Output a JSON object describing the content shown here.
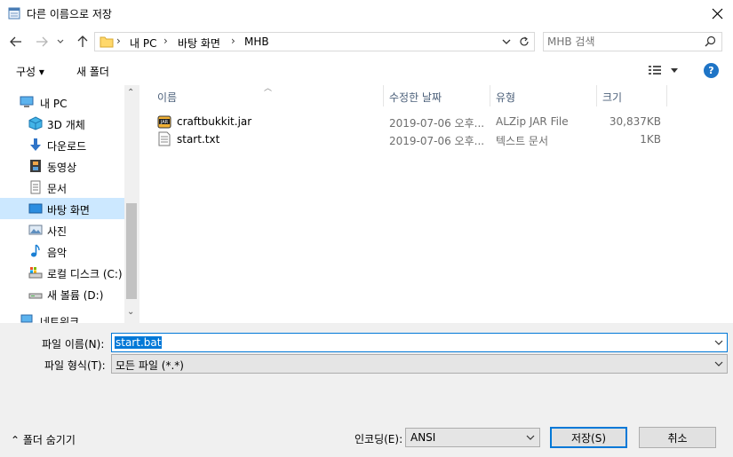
{
  "window": {
    "title": "다른 이름으로 저장",
    "close_glyph": "✕"
  },
  "address": {
    "breadcrumb": [
      "내 PC",
      "바탕 화면",
      "MHB"
    ],
    "separator": "›"
  },
  "search": {
    "placeholder": "MHB 검색"
  },
  "toolbar": {
    "organize_label": "구성 ▾",
    "new_folder_label": "새 폴더",
    "help_label": "?"
  },
  "nav": {
    "items": [
      {
        "label": "내 PC",
        "icon": "computer-icon"
      },
      {
        "label": "3D 개체",
        "icon": "cube-icon"
      },
      {
        "label": "다운로드",
        "icon": "download-icon"
      },
      {
        "label": "동영상",
        "icon": "film-icon"
      },
      {
        "label": "문서",
        "icon": "document-icon"
      },
      {
        "label": "바탕 화면",
        "icon": "desktop-icon",
        "selected": true
      },
      {
        "label": "사진",
        "icon": "pictures-icon"
      },
      {
        "label": "음악",
        "icon": "music-icon"
      },
      {
        "label": "로컬 디스크 (C:)",
        "icon": "drive-c-icon"
      },
      {
        "label": "새 볼륨 (D:)",
        "icon": "drive-d-icon"
      },
      {
        "label": "네트워크",
        "icon": "network-icon"
      }
    ]
  },
  "files": {
    "columns": [
      "이름",
      "수정한 날짜",
      "유형",
      "크기"
    ],
    "rows": [
      {
        "name": "craftbukkit.jar",
        "date": "2019-07-06 오후...",
        "type": "ALZip JAR File",
        "size": "30,837KB",
        "icon": "jar-icon"
      },
      {
        "name": "start.txt",
        "date": "2019-07-06 오후...",
        "type": "텍스트 문서",
        "size": "1KB",
        "icon": "text-file-icon"
      }
    ]
  },
  "form": {
    "filename_label": "파일 이름(N):",
    "filename_value": "start.bat",
    "filetype_label": "파일 형식(T):",
    "filetype_value": "모든 파일 (*.*)",
    "hide_folders_label": "⌃  폴더 숨기기",
    "encoding_label": "인코딩(E):",
    "encoding_value": "ANSI",
    "save_label": "저장(S)",
    "cancel_label": "취소"
  },
  "colors": {
    "accent": "#0078d7",
    "selection": "#cce8ff",
    "header_text": "#4c607a"
  }
}
